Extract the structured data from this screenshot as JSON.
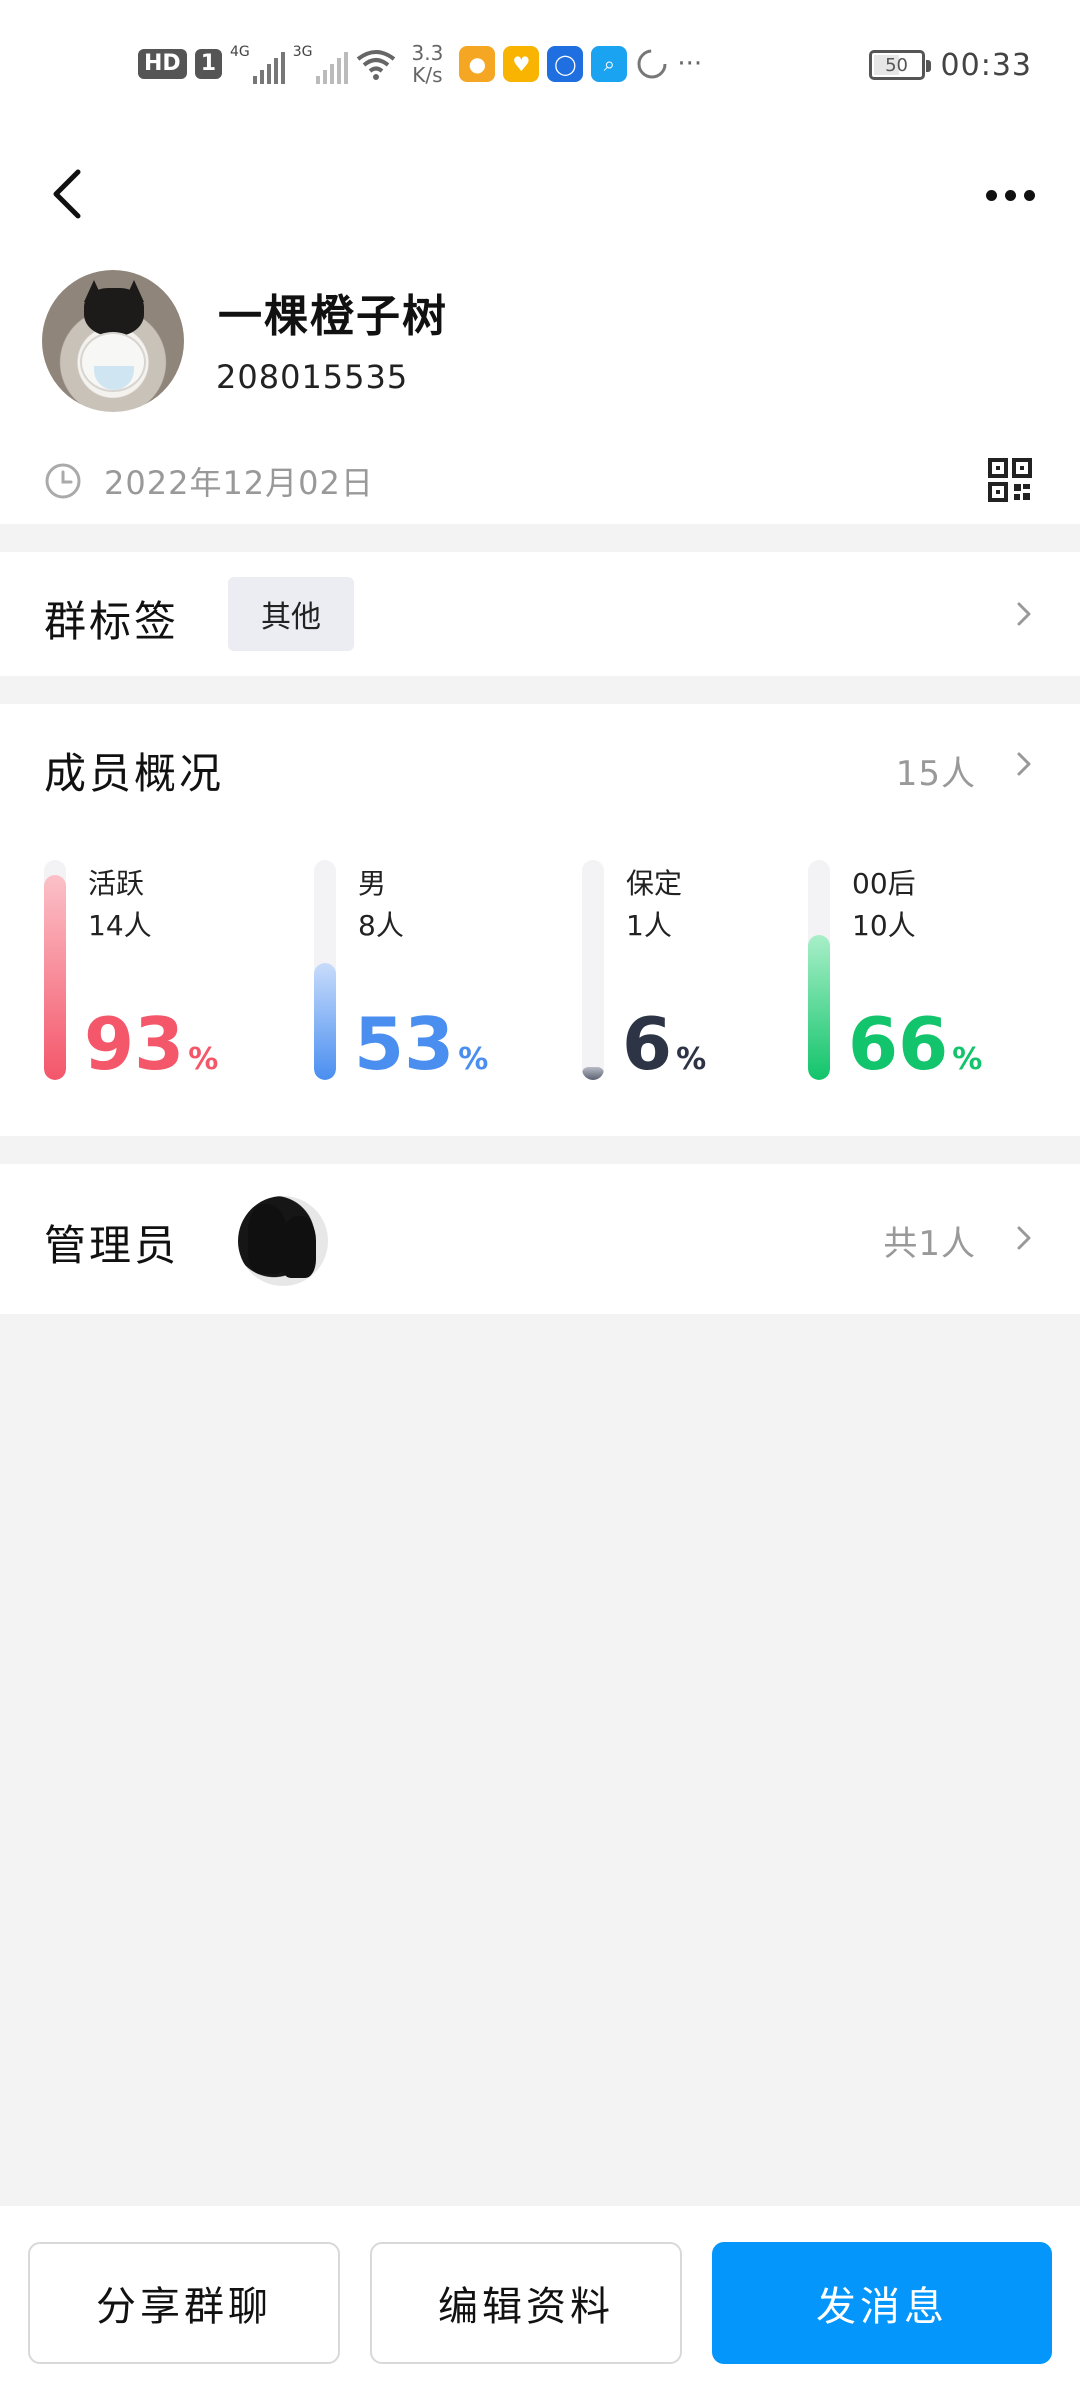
{
  "status_bar": {
    "hd_badge": "HD",
    "sim_badge": "1",
    "net1": "4G",
    "net2": "3G",
    "speed_value": "3.3",
    "speed_unit": "K/s",
    "battery": "50",
    "time": "00:33",
    "more_dots": "···"
  },
  "header": {
    "group_name": "一棵橙子树",
    "group_id": "208015535",
    "created_date": "2022年12月02日"
  },
  "tags": {
    "title": "群标签",
    "chip": "其他"
  },
  "members": {
    "title": "成员概况",
    "count": "15人",
    "stats": [
      {
        "label": "活跃",
        "count": "14人",
        "percent": "93",
        "unit": "%",
        "fraction": 0.93,
        "color": "#f4566a",
        "fill_from": "#fbc1c8",
        "fill_to": "#f4566a"
      },
      {
        "label": "男",
        "count": "8人",
        "percent": "53",
        "unit": "%",
        "fraction": 0.53,
        "color": "#4a8ef0",
        "fill_from": "#c8dcfb",
        "fill_to": "#4a8ef0"
      },
      {
        "label": "保定",
        "count": "1人",
        "percent": "6",
        "unit": "%",
        "fraction": 0.06,
        "color": "#2c3445",
        "fill_from": "#b7bcc6",
        "fill_to": "#5a6070"
      },
      {
        "label": "00后",
        "count": "10人",
        "percent": "66",
        "unit": "%",
        "fraction": 0.66,
        "color": "#12c46b",
        "fill_from": "#a8efc8",
        "fill_to": "#12c46b"
      }
    ]
  },
  "admins": {
    "title": "管理员",
    "total": "共1人"
  },
  "actions": {
    "share": "分享群聊",
    "edit": "编辑资料",
    "send": "发消息"
  },
  "colors": {
    "primary": "#0496fb",
    "muted_text": "#999999",
    "divider_bg": "#f3f3f3"
  },
  "icons": {
    "back": "back-arrow-icon",
    "more": "more-dots-icon",
    "clock": "clock-icon",
    "qr": "qr-code-icon",
    "chevron": "chevron-right-icon"
  }
}
